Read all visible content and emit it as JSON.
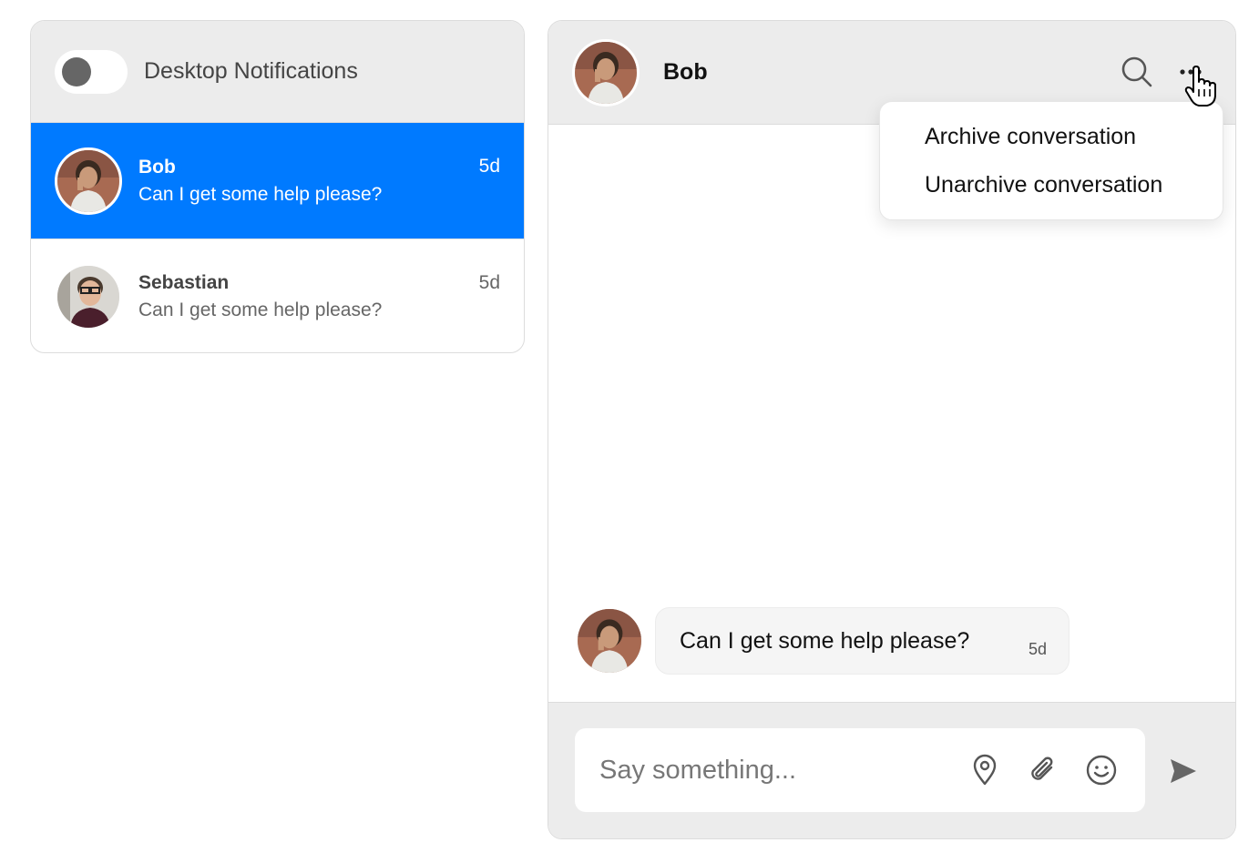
{
  "notifications": {
    "label": "Desktop Notifications",
    "enabled": false
  },
  "conversations": [
    {
      "name": "Bob",
      "preview": "Can I get some help please?",
      "time": "5d",
      "active": true
    },
    {
      "name": "Sebastian",
      "preview": "Can I get some help please?",
      "time": "5d",
      "active": false
    }
  ],
  "chat": {
    "title": "Bob",
    "menu": {
      "items": [
        "Archive conversation",
        "Unarchive conversation"
      ]
    },
    "messages": [
      {
        "text": "Can I get some help please?",
        "time": "5d"
      }
    ],
    "composer": {
      "placeholder": "Say something..."
    }
  },
  "colors": {
    "accent": "#007aff",
    "header_bg": "#ececec"
  }
}
